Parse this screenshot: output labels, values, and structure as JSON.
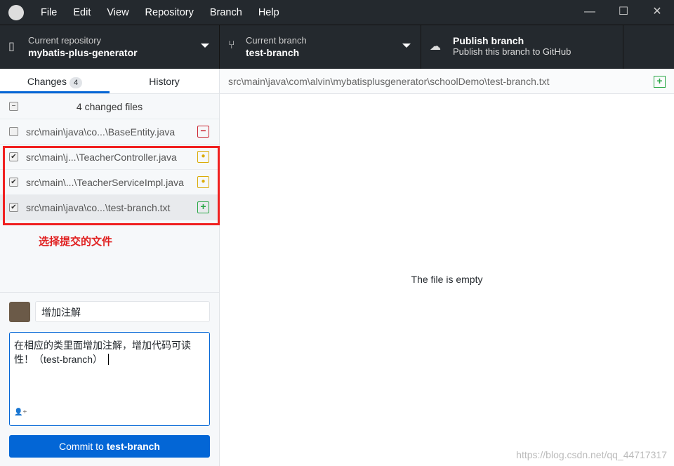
{
  "menu": [
    "File",
    "Edit",
    "View",
    "Repository",
    "Branch",
    "Help"
  ],
  "repo": {
    "label": "Current repository",
    "name": "mybatis-plus-generator"
  },
  "branch": {
    "label": "Current branch",
    "name": "test-branch"
  },
  "publish": {
    "title": "Publish branch",
    "subtitle": "Publish this branch to GitHub"
  },
  "tabs": {
    "changes": "Changes",
    "count": "4",
    "history": "History"
  },
  "changed_header": "4 changed files",
  "files": [
    {
      "path": "src\\main\\java\\co...\\BaseEntity.java",
      "checked": false,
      "status": "deleted",
      "color": "#cb2431"
    },
    {
      "path": "src\\main\\j...\\TeacherController.java",
      "checked": true,
      "status": "modified",
      "color": "#dbab09"
    },
    {
      "path": "src\\main\\...\\TeacherServiceImpl.java",
      "checked": true,
      "status": "modified",
      "color": "#dbab09"
    },
    {
      "path": "src\\main\\java\\co...\\test-branch.txt",
      "checked": true,
      "status": "added",
      "color": "#28a745"
    }
  ],
  "annotation": "选择提交的文件",
  "commit": {
    "summary": "增加注解",
    "description": "在相应的类里面增加注解，增加代码可读性！（test-branch）",
    "button_prefix": "Commit to ",
    "button_branch": "test-branch"
  },
  "diff": {
    "path": "src\\main\\java\\com\\alvin\\mybatisplusgenerator\\schoolDemo\\test-branch.txt",
    "message": "The file is empty"
  },
  "watermark": "https://blog.csdn.net/qq_44717317"
}
